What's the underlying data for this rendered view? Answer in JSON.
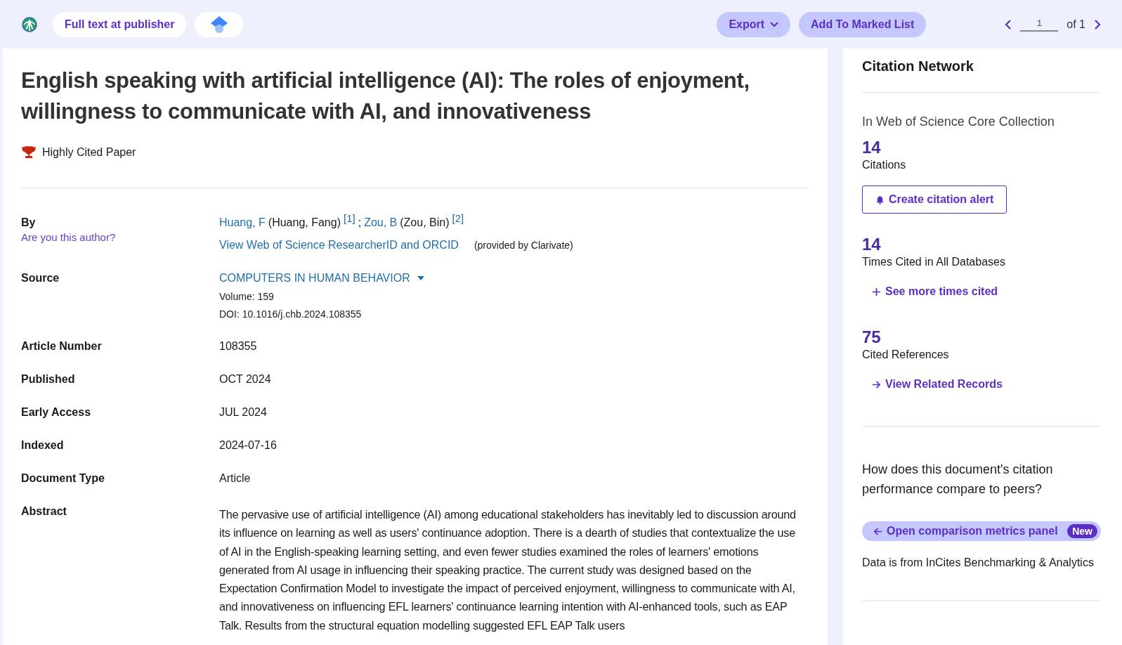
{
  "toolbar": {
    "full_text_button": "Full text at publisher",
    "export_button": "Export",
    "marked_list_button": "Add To Marked List",
    "pager": {
      "page": "1",
      "of_label": "of 1"
    }
  },
  "record": {
    "title": "English speaking with artificial intelligence (AI): The roles of enjoyment, willingness to communicate with AI, and innovativeness",
    "badge": "Highly Cited Paper",
    "fields": [
      {
        "kind": "authors",
        "label": "By",
        "sublink": "Are you this author?",
        "authors": [
          {
            "short": "Huang, F",
            "full": "(Huang, Fang)",
            "ref": "[1]"
          },
          {
            "short": "Zou, B",
            "full": "(Zou, Bin)",
            "ref": "[2]"
          }
        ],
        "separator": ";",
        "researcher_link": "View Web of Science ResearcherID and ORCID",
        "provided_note": "(provided by Clarivate)"
      },
      {
        "kind": "source",
        "label": "Source",
        "journal": "COMPUTERS IN HUMAN BEHAVIOR",
        "lines": [
          "Volume: 159",
          "DOI: 10.1016/j.chb.2024.108355"
        ]
      },
      {
        "kind": "text",
        "label": "Article Number",
        "value": "108355"
      },
      {
        "kind": "text",
        "label": "Published",
        "value": "OCT 2024"
      },
      {
        "kind": "text",
        "label": "Early Access",
        "value": "JUL 2024"
      },
      {
        "kind": "text",
        "label": "Indexed",
        "value": "2024-07-16"
      },
      {
        "kind": "text",
        "label": "Document Type",
        "value": "Article"
      },
      {
        "kind": "abstract",
        "label": "Abstract",
        "value": "The pervasive use of artificial intelligence (AI) among educational stakeholders has inevitably led to discussion around its influence on learning as well as users' continuance adoption. There is a dearth of studies that contextualize the use of AI in the English-speaking learning setting, and even fewer studies examined the roles of learners' emotions generated from AI usage in influencing their speaking practice. The current study was designed based on the Expectation Confirmation Model to investigate the impact of perceived enjoyment, willingness to communicate with AI, and innovativeness on influencing EFL learners' continuance learning intention with AI-enhanced tools, such as EAP Talk. Results from the structural equation modelling suggested EFL EAP Talk users"
      }
    ]
  },
  "citation_network": {
    "title": "Citation Network",
    "collection": "In Web of Science Core Collection",
    "metrics": [
      {
        "count": "14",
        "label": "Citations",
        "action": "Create citation alert",
        "kind": "alert"
      },
      {
        "count": "14",
        "label": "Times Cited in All Databases",
        "action": "See more times cited",
        "kind": "plus"
      },
      {
        "count": "75",
        "label": "Cited References",
        "action": "View Related Records",
        "kind": "arrow"
      }
    ],
    "question": "How does this document's citation performance compare to peers?",
    "comparison_button": "Open comparison metrics panel",
    "new_badge": "New",
    "source_note": "Data is from InCites Benchmarking & Analytics"
  }
}
